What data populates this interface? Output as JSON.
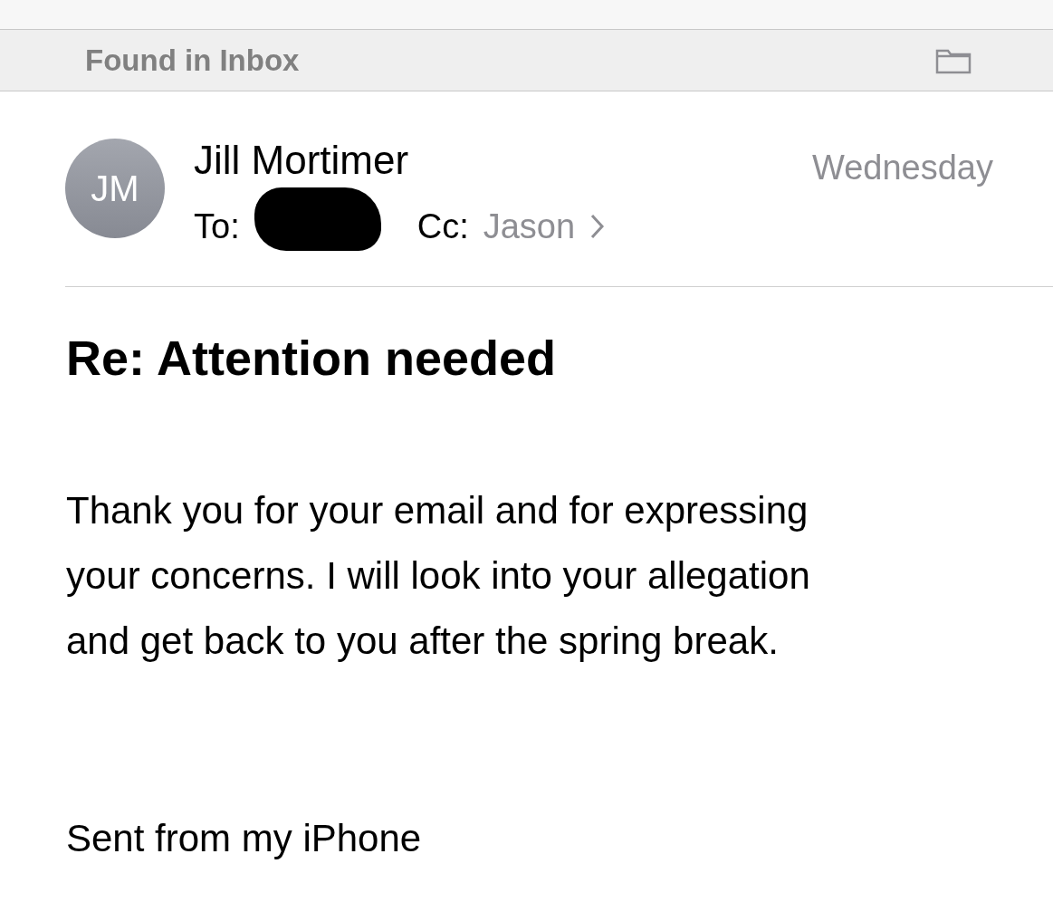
{
  "header": {
    "title": "Found in Inbox"
  },
  "message": {
    "avatar_initials": "JM",
    "sender": "Jill Mortimer",
    "date": "Wednesday",
    "to_label": "To:",
    "to_redacted": true,
    "cc_label": "Cc:",
    "cc": "Jason"
  },
  "subject": "Re: Attention needed",
  "body": "Thank you for your email and for expressing your concerns. I will look into your allegation and get back to you after the spring break.",
  "signature": "Sent from my iPhone"
}
